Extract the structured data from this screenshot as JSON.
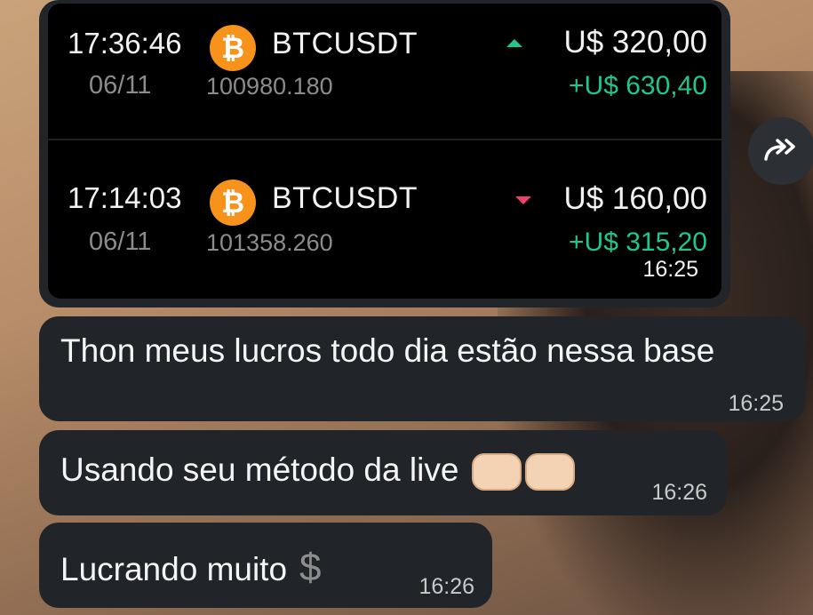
{
  "trades": [
    {
      "time": "17:36:46",
      "date": "06/11",
      "coin_symbol": "₿",
      "pair": "BTCUSDT",
      "price": "100980.180",
      "direction": "up",
      "amount": "U$ 320,00",
      "profit": "+U$ 630,40"
    },
    {
      "time": "17:14:03",
      "date": "06/11",
      "coin_symbol": "₿",
      "pair": "BTCUSDT",
      "price": "101358.260",
      "direction": "down",
      "amount": "U$ 160,00",
      "profit": "+U$ 315,20"
    }
  ],
  "media_message": {
    "time": "16:25"
  },
  "messages": [
    {
      "text": "Thon meus lucros todo dia estão nessa base",
      "time": "16:25"
    },
    {
      "text": "Usando seu método da live",
      "emoji": "fist-bump-emoji",
      "time": "16:26"
    },
    {
      "text": "Lucrando muito",
      "emoji": "heavy-dollar-sign-emoji",
      "emoji_char": "$",
      "time": "16:26"
    }
  ],
  "colors": {
    "bubble": "#212529",
    "up_green": "#1ec78c",
    "down_red": "#f23d6d",
    "bitcoin_orange": "#f7931a"
  }
}
